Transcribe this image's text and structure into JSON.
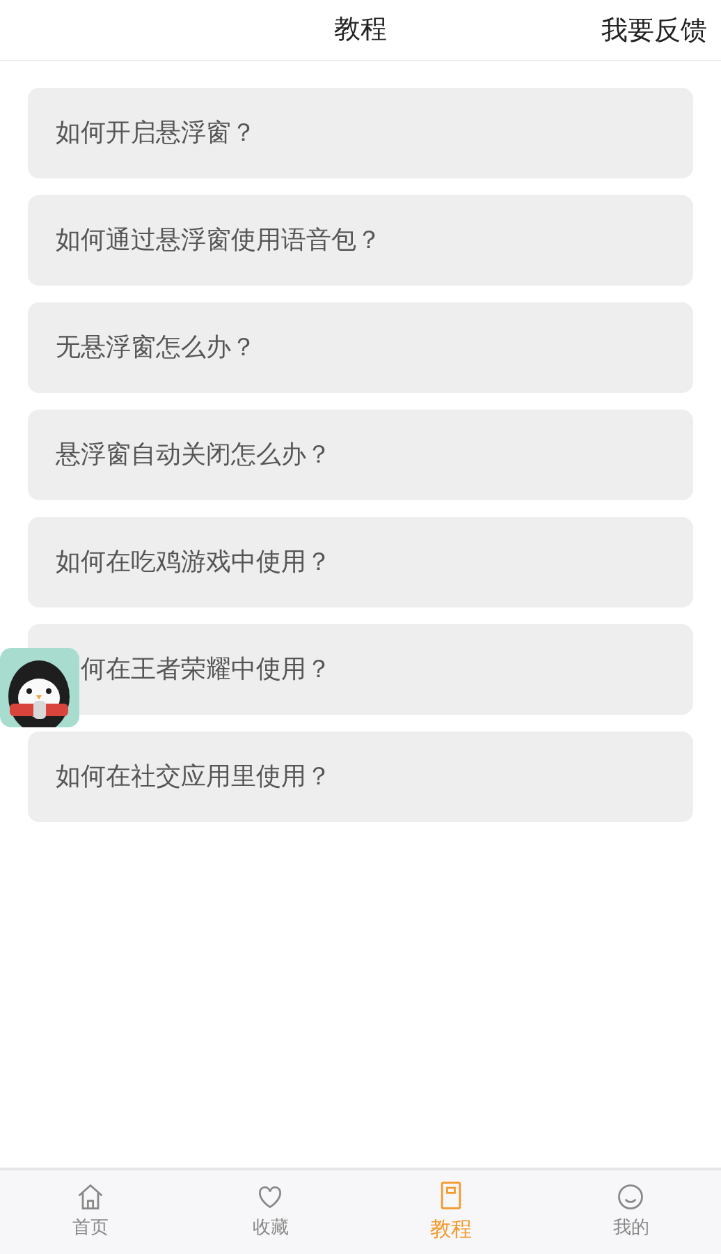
{
  "header": {
    "title": "教程",
    "action": "我要反馈"
  },
  "items": [
    {
      "text": "如何开启悬浮窗？",
      "kind": "plain"
    },
    {
      "text": "如何通过悬浮窗使用语音包？",
      "kind": "plain"
    },
    {
      "text": "无悬浮窗怎么办？",
      "kind": "plain"
    },
    {
      "text": "悬浮窗自动关闭怎么办？",
      "kind": "plain"
    },
    {
      "text": "如何在吃鸡游戏中使用？",
      "kind": "plain"
    },
    {
      "text": "何在王者荣耀中使用？",
      "kind": "overlapped"
    },
    {
      "text": "如何在社交应用里使用？",
      "kind": "plain"
    }
  ],
  "tabs": [
    {
      "label": "首页",
      "kind": "home",
      "selected": false
    },
    {
      "label": "收藏",
      "kind": "heart",
      "selected": false
    },
    {
      "label": "教程",
      "kind": "book",
      "selected": true
    },
    {
      "label": "我的",
      "kind": "face",
      "selected": false
    }
  ]
}
